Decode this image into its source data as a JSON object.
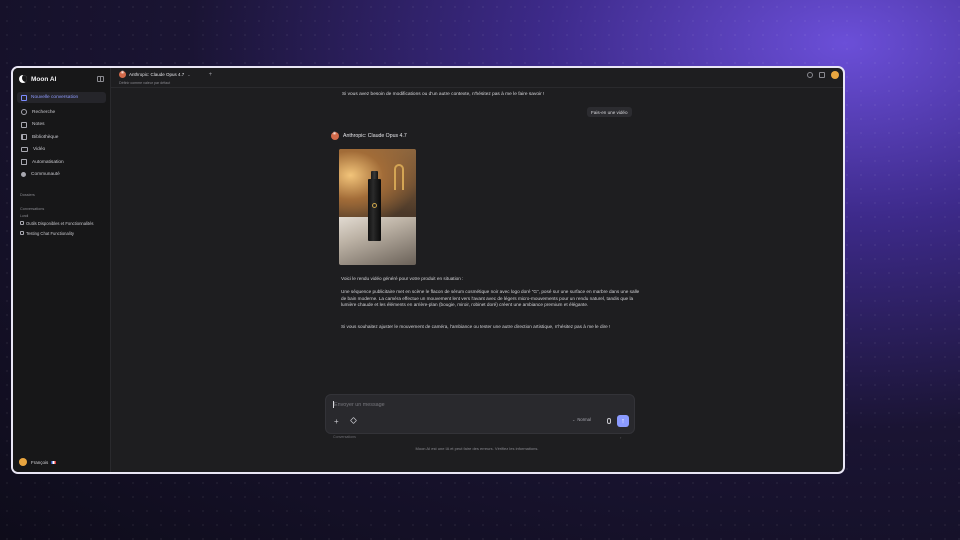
{
  "app": {
    "name": "Moon AI"
  },
  "sidebar": {
    "new_conversation": "Nouvelle conversation",
    "items": [
      {
        "label": "Recherche",
        "icon": "search-icon"
      },
      {
        "label": "Notes",
        "icon": "notes-icon"
      },
      {
        "label": "Bibliothèque",
        "icon": "library-icon"
      },
      {
        "label": "Vidéo",
        "icon": "video-icon"
      },
      {
        "label": "Automatisation",
        "icon": "automation-icon"
      },
      {
        "label": "Communauté",
        "icon": "community-icon"
      }
    ],
    "folders_label": "Dossiers",
    "conversations_label": "Conversations",
    "today_label": "Lundi",
    "conversations": [
      {
        "label": "Outils Disponibles et Fonctionnalités",
        "icon": "tool-icon"
      },
      {
        "label": "Testing Chat Functionality",
        "icon": "chat-icon"
      }
    ],
    "user": {
      "name": "François"
    }
  },
  "topbar": {
    "model": "Anthropic: Claude Opus 4.7",
    "subtitle": "Définir comme valeur par défaut"
  },
  "chat": {
    "prev_message_tail": "Si vous avez besoin de modifications ou d'un autre contexte, n'hésitez pas à me le faire savoir !",
    "user_message": "Fais-en une vidéo",
    "assistant_name": "Anthropic: Claude Opus 4.7",
    "response": {
      "intro": "Voici le rendu vidéo généré pour votre produit en situation :",
      "paragraph1": "Une séquence publicitaire met en scène le flacon de sérum cosmétique noir avec logo doré \"G\", posé sur une surface en marbre dans une salle de bain moderne. La caméra effectue un mouvement lent vers l'avant avec de légers micro-mouvements pour un rendu naturel, tandis que la lumière chaude et les éléments en arrière-plan (bougie, miroir, robinet doré) créent une ambiance premium et élégante.",
      "paragraph2": "Si vous souhaitez ajuster le mouvement de caméra, l'ambiance ou tester une autre direction artistique, n'hésitez pas à me le dire !"
    }
  },
  "composer": {
    "placeholder": "Envoyer un message",
    "mode": "Normal",
    "hint": "Conversations",
    "hint_right": "›"
  },
  "disclaimer": "Moon AI est une IA et peut faire des erreurs. Vérifiez les informations.",
  "colors": {
    "accent": "#8b9bff",
    "background": "#1e1e20",
    "sidebar": "#171718"
  }
}
